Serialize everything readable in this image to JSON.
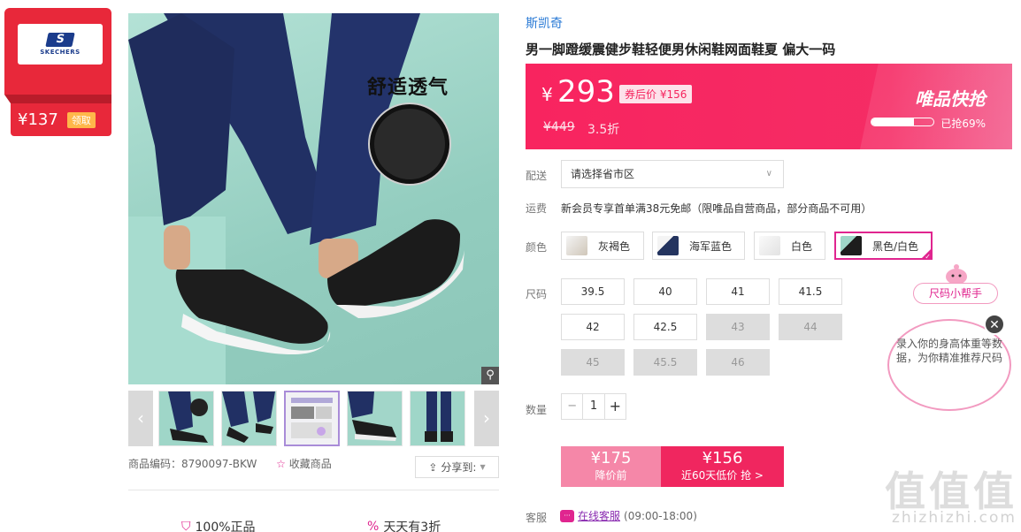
{
  "coupon": {
    "brand_logo": "SKECHERS",
    "price": "¥137",
    "get_label": "领取"
  },
  "main_image": {
    "tagline": "舒适透气",
    "zoom_icon": "magnifier-icon"
  },
  "thumbs": {
    "count": 6,
    "prev_icon": "chevron-left-icon",
    "next_icon": "chevron-right-icon"
  },
  "product": {
    "code_label": "商品编码：",
    "code": "8790097-BKW",
    "favorite_label": "收藏商品",
    "share_label": "分享到:",
    "brand": "斯凯奇",
    "title": "男一脚蹬缓震健步鞋轻便男休闲鞋网面鞋夏 偏大一码"
  },
  "guarantees": [
    "100%正品",
    "天天有3折"
  ],
  "price": {
    "currency": "¥",
    "amount": "293",
    "coupon_price": "券后价 ¥156",
    "original": "¥449",
    "discount": "3.5折",
    "flash_title": "唯品快抢",
    "sold_text": "已抢69%",
    "sold_ratio": 0.69
  },
  "delivery": {
    "label": "配送",
    "placeholder": "请选择省市区"
  },
  "shipping": {
    "label": "运费",
    "text": "新会员专享首单满38元免邮（限唯品自营商品，部分商品不可用）"
  },
  "colors": {
    "label": "颜色",
    "options": [
      "灰褐色",
      "海军蓝色",
      "白色",
      "黑色/白色"
    ],
    "selected": "黑色/白色"
  },
  "sizes": {
    "label": "尺码",
    "options": [
      "39.5",
      "40",
      "41",
      "41.5",
      "42",
      "42.5",
      "43",
      "44",
      "45",
      "45.5",
      "46"
    ],
    "unavailable": [
      "43",
      "44",
      "45",
      "45.5",
      "46"
    ]
  },
  "quantity": {
    "label": "数量",
    "value": "1",
    "minus": "−",
    "plus": "+"
  },
  "buy": {
    "left_price": "¥175",
    "left_label": "降价前",
    "right_price": "¥156",
    "right_label": "近60天低价 抢 >"
  },
  "service": {
    "label": "客服",
    "link": "在线客服",
    "hours": "(09:00-18:00)"
  },
  "size_helper": {
    "tag": "尺码小帮手",
    "text": "录入你的身高体重等数据，为你精准推荐尺码"
  },
  "watermark": {
    "text": "值值值",
    "url": "zhizhizhi.com"
  },
  "colors_hex": {
    "accent": "#f52c65",
    "brand_blue": "#2b7bd6",
    "coupon_red": "#e8283a"
  }
}
